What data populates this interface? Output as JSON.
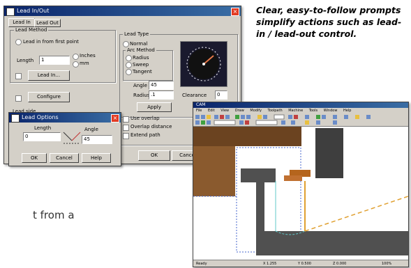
{
  "caption": "Clear, easy-to-follow prompts simplify actions such as lead-in / lead-out control.",
  "body_text_fragment": "t from a",
  "dialog_main": {
    "title": "Lead In/Out",
    "tabs": [
      "Lead In",
      "Lead Out"
    ],
    "group_left_label": "Lead Method",
    "option_1": "Lead in from first point",
    "length_label": "Length",
    "length_value": "1",
    "radio_inches": "Inches",
    "radio_mm": "mm",
    "button_1": "Lead In...",
    "button_2": "Configure",
    "side_label": "Lead side",
    "group_right_label": "Lead Type",
    "radio_normal": "Normal",
    "arc_group_label": "Arc Method",
    "arc_opt_1": "Radius",
    "arc_opt_2": "Sweep",
    "arc_opt_3": "Tangent",
    "angle_label": "Angle",
    "angle_value": "45",
    "radius_label": "Radius",
    "radius_value": ".1",
    "apply_button": "Apply",
    "chk_1": "Use overlap",
    "chk_2": "Overlap distance",
    "chk_3": "Extend path",
    "clearance_label": "Clearance",
    "clearance_value": "0",
    "ok_button": "OK",
    "cancel_button": "Cancel"
  },
  "dialog_small": {
    "title": "Lead Options",
    "field_1_label": "Length",
    "field_1_value": "0",
    "field_2_label": "Angle",
    "field_2_value": "45",
    "ok_button": "OK",
    "cancel_button": "Cancel",
    "help_button": "Help"
  },
  "app_window": {
    "title": "CAM",
    "menu": [
      "File",
      "Edit",
      "View",
      "Draw",
      "Modify",
      "Toolpath",
      "Machine",
      "Tools",
      "Window",
      "Help"
    ],
    "status_items": [
      "Ready",
      "X 1.255",
      "Y 0.500",
      "Z 0.000",
      "100%"
    ]
  },
  "colors": {
    "dialog_bg": "#d4d0c8",
    "titlebar": "#0a246a",
    "preview_bg": "#1a1a2e",
    "wood": "#8a5a2e",
    "part_dark": "#4a4a4a",
    "toolpath": "#e0a030"
  }
}
